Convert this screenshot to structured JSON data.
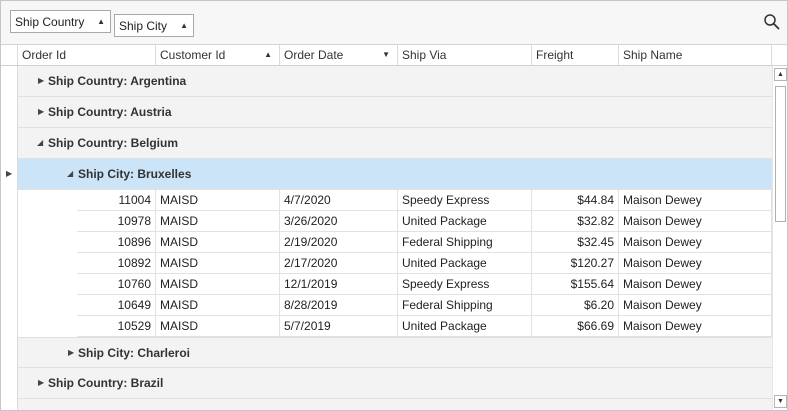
{
  "group_panel": {
    "chips": [
      {
        "label": "Ship Country",
        "sort": "ascending"
      },
      {
        "label": "Ship City",
        "sort": "ascending"
      }
    ],
    "search_icon": "search-icon"
  },
  "columns": [
    {
      "label": "Order Id",
      "sort": ""
    },
    {
      "label": "Customer Id",
      "sort": "ascending"
    },
    {
      "label": "Order Date",
      "sort": "descending"
    },
    {
      "label": "Ship Via",
      "sort": ""
    },
    {
      "label": "Freight",
      "sort": ""
    },
    {
      "label": "Ship Name",
      "sort": ""
    }
  ],
  "sort_glyphs": {
    "ascending": "▲",
    "descending": "▼"
  },
  "groups": {
    "argentina": {
      "label": "Ship Country: Argentina",
      "expanded": false
    },
    "austria": {
      "label": "Ship Country: Austria",
      "expanded": false
    },
    "belgium": {
      "label": "Ship Country: Belgium",
      "expanded": true
    },
    "bruxelles": {
      "label": "Ship City: Bruxelles",
      "expanded": true,
      "selected": true
    },
    "charleroi": {
      "label": "Ship City: Charleroi",
      "expanded": false
    },
    "brazil": {
      "label": "Ship Country: Brazil",
      "expanded": false
    }
  },
  "rows": [
    {
      "order_id": "11004",
      "customer_id": "MAISD",
      "order_date": "4/7/2020",
      "ship_via": "Speedy Express",
      "freight": "$44.84",
      "ship_name": "Maison Dewey"
    },
    {
      "order_id": "10978",
      "customer_id": "MAISD",
      "order_date": "3/26/2020",
      "ship_via": "United Package",
      "freight": "$32.82",
      "ship_name": "Maison Dewey"
    },
    {
      "order_id": "10896",
      "customer_id": "MAISD",
      "order_date": "2/19/2020",
      "ship_via": "Federal Shipping",
      "freight": "$32.45",
      "ship_name": "Maison Dewey"
    },
    {
      "order_id": "10892",
      "customer_id": "MAISD",
      "order_date": "2/17/2020",
      "ship_via": "United Package",
      "freight": "$120.27",
      "ship_name": "Maison Dewey"
    },
    {
      "order_id": "10760",
      "customer_id": "MAISD",
      "order_date": "12/1/2019",
      "ship_via": "Speedy Express",
      "freight": "$155.64",
      "ship_name": "Maison Dewey"
    },
    {
      "order_id": "10649",
      "customer_id": "MAISD",
      "order_date": "8/28/2019",
      "ship_via": "Federal Shipping",
      "freight": "$6.20",
      "ship_name": "Maison Dewey"
    },
    {
      "order_id": "10529",
      "customer_id": "MAISD",
      "order_date": "5/7/2019",
      "ship_via": "United Package",
      "freight": "$66.69",
      "ship_name": "Maison Dewey"
    }
  ],
  "glyphs": {
    "expanded": "◢",
    "collapsed": "▶",
    "current_row": "▶",
    "scroll_up": "▲",
    "scroll_down": "▼"
  },
  "colors": {
    "selected_row": "#cce4f7",
    "group_row": "#f3f3f3"
  }
}
